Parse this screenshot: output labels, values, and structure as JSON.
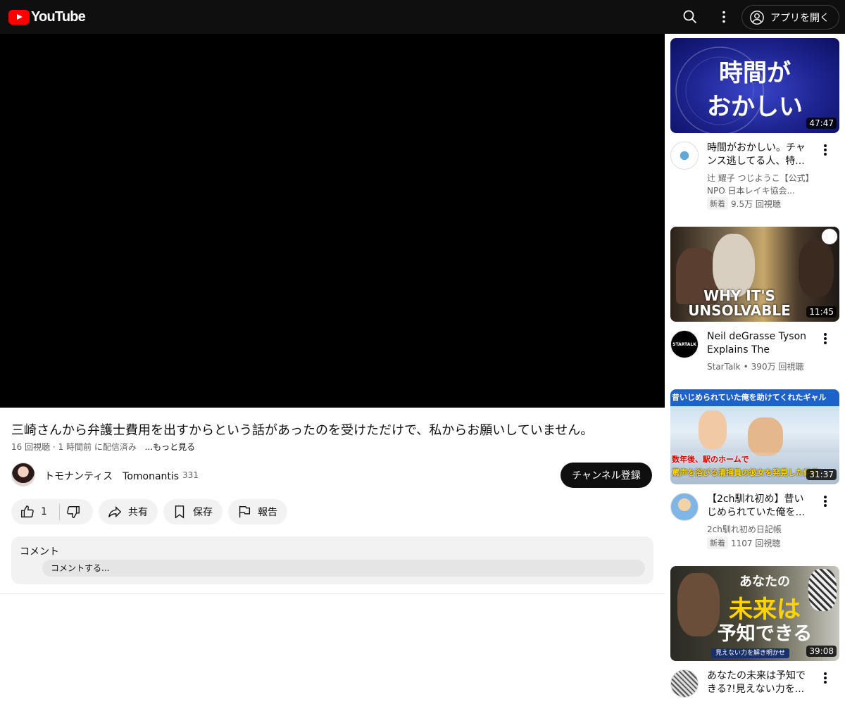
{
  "header": {
    "logo_text": "YouTube",
    "search_icon": "search-icon",
    "more_icon": "more-vert-icon",
    "open_app_label": "アプリを開く"
  },
  "video": {
    "title": "三崎さんから弁護士費用を出すからという話があったのを受けただけで、私からお願いしていません。",
    "views": "16 回視聴",
    "published": "1 時間前 に配信済み",
    "more_label": "...もっと見る"
  },
  "channel": {
    "name": "トモナンティス　Tomonantis",
    "subscribers": "331",
    "subscribe_label": "チャンネル登録"
  },
  "actions": {
    "like_count": "1",
    "share_label": "共有",
    "save_label": "保存",
    "report_label": "報告"
  },
  "comments": {
    "heading": "コメント",
    "placeholder": "コメントする..."
  },
  "recommendations": [
    {
      "thumb_text": [
        "時間が",
        "おかしい"
      ],
      "duration": "47:47",
      "title": "時間がおかしい。チャンス逃してる人、特...",
      "channel": "辻 耀子 つじようこ【公式】NPO 日本レイキ協会...",
      "badge": "新着",
      "views": "9.5万 回視聴"
    },
    {
      "thumb_text": [
        "WHY IT'S",
        "UNSOLVABLE"
      ],
      "duration": "11:45",
      "title": "Neil deGrasse Tyson Explains The Three-...",
      "channel": "StarTalk",
      "views": "390万 回視聴",
      "avatar_text": "STARTALK"
    },
    {
      "thumb_text": [
        "昔いじめられていた俺を助けてくれたギャル",
        "数年後、駅のホームで",
        "罵声を浴びる清掃員の彼女を発見した結果"
      ],
      "duration": "31:37",
      "title": "【2ch馴れ初め】昔いじめられていた俺を...",
      "channel": "2ch馴れ初め日記帳",
      "badge": "新着",
      "views": "1107 回視聴"
    },
    {
      "thumb_text": [
        "あなたの",
        "未来は",
        "予知できる",
        "見えない力を解き明かせ"
      ],
      "duration": "39:08",
      "title": "あなたの未来は予知できる?!見えない力を..."
    }
  ]
}
